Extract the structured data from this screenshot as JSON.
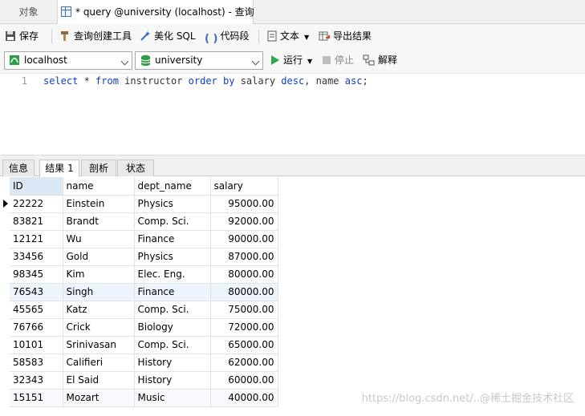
{
  "tabs": {
    "inactive_label": "对象",
    "active_label": "* query @university (localhost) - 查询"
  },
  "toolbar": {
    "save": "保存",
    "query_builder": "查询创建工具",
    "beautify_sql": "美化 SQL",
    "code_snippet": "代码段",
    "text": "文本",
    "export": "导出结果"
  },
  "connection": {
    "server": "localhost",
    "database": "university",
    "run": "运行",
    "stop": "停止",
    "explain": "解释"
  },
  "editor": {
    "line_number": "1",
    "tokens": [
      {
        "t": "select",
        "k": true
      },
      {
        "t": " * ",
        "k": false
      },
      {
        "t": "from",
        "k": true
      },
      {
        "t": " instructor ",
        "k": false
      },
      {
        "t": "order",
        "k": true
      },
      {
        "t": " ",
        "k": false
      },
      {
        "t": "by",
        "k": true
      },
      {
        "t": " salary ",
        "k": false
      },
      {
        "t": "desc",
        "k": true
      },
      {
        "t": ", name ",
        "k": false
      },
      {
        "t": "asc",
        "k": true
      },
      {
        "t": ";",
        "k": false
      }
    ]
  },
  "result_tabs": [
    "信息",
    "结果 1",
    "剖析",
    "状态"
  ],
  "result_active": 1,
  "grid": {
    "columns": [
      "ID",
      "name",
      "dept_name",
      "salary"
    ],
    "rows": [
      [
        "22222",
        "Einstein",
        "Physics",
        "95000.00"
      ],
      [
        "83821",
        "Brandt",
        "Comp. Sci.",
        "92000.00"
      ],
      [
        "12121",
        "Wu",
        "Finance",
        "90000.00"
      ],
      [
        "33456",
        "Gold",
        "Physics",
        "87000.00"
      ],
      [
        "98345",
        "Kim",
        "Elec. Eng.",
        "80000.00"
      ],
      [
        "76543",
        "Singh",
        "Finance",
        "80000.00"
      ],
      [
        "45565",
        "Katz",
        "Comp. Sci.",
        "75000.00"
      ],
      [
        "76766",
        "Crick",
        "Biology",
        "72000.00"
      ],
      [
        "10101",
        "Srinivasan",
        "Comp. Sci.",
        "65000.00"
      ],
      [
        "58583",
        "Califieri",
        "History",
        "62000.00"
      ],
      [
        "32343",
        "El Said",
        "History",
        "60000.00"
      ],
      [
        "15151",
        "Mozart",
        "Music",
        "40000.00"
      ]
    ]
  },
  "watermark": "https://blog.csdn.net/..@稀土掘金技术社区",
  "colors": {
    "keyword": "#0b3ec9",
    "header_selected": "#dde8f7"
  }
}
